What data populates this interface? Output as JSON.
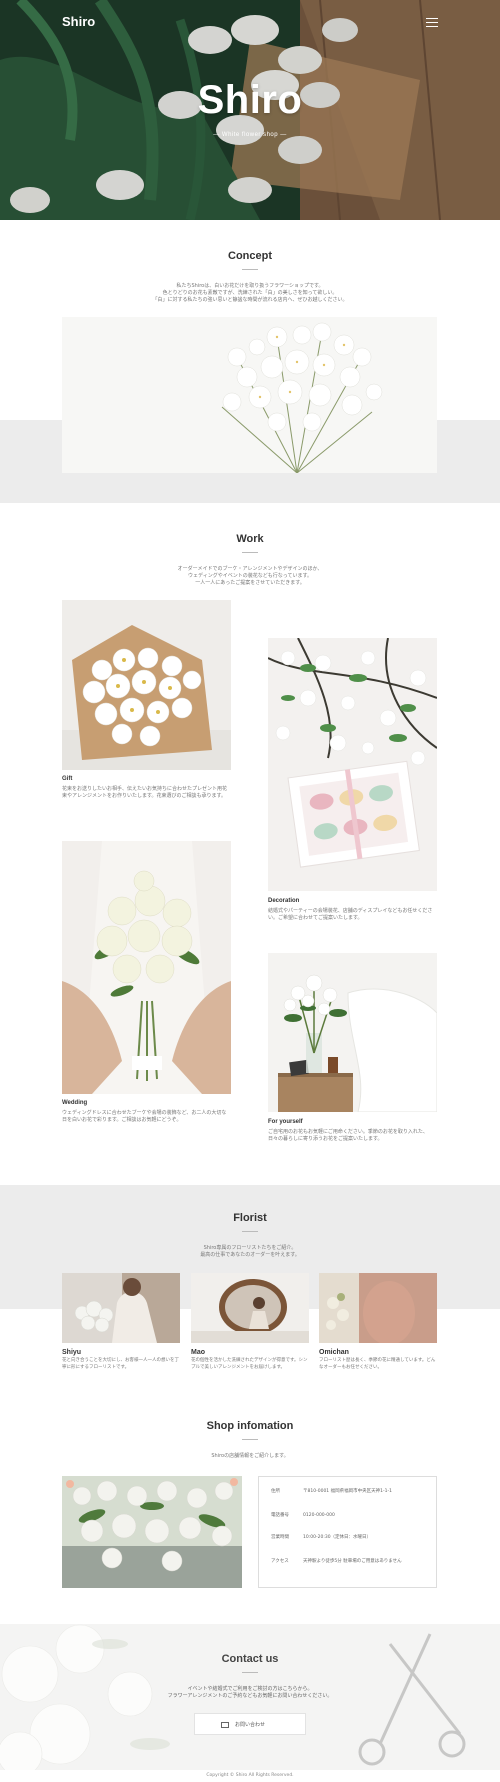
{
  "header": {
    "brand": "Shiro",
    "menu_icon": "hamburger-menu-icon"
  },
  "hero": {
    "title": "Shiro",
    "subtitle": "— White flower shop —"
  },
  "concept": {
    "title": "Concept",
    "text": [
      "私たちShiroは、白いお花だけを取り扱うフラワーショップです。",
      "色とりどりのお花も素敵ですが、洗練された「白」の美しさを知って欲しい。",
      "「白」に対する私たちの強い思いと静謐な時間が流れる店内へ、ぜひお越しください。"
    ]
  },
  "work": {
    "title": "Work",
    "text": [
      "オーダーメイドでのブーケ・アレンジメントやデザインのほか、",
      "ウェディングやイベントの装花なども行なっています。",
      "一人一人にあったご提案をさせていただきます。"
    ],
    "items": [
      {
        "caption": "Gift",
        "desc": "花束をお送りしたいお相手、伝えたいお気持ちに合わせたプレゼント用花束やアレンジメントをお作りいたします。花束選びのご相談も承ります。"
      },
      {
        "caption": "Decoration",
        "desc": "結婚式やパーティーの会場装花、店舗のディスプレイなどもお任せください。ご希望に合わせてご提案いたします。"
      },
      {
        "caption": "Wedding",
        "desc": "ウェディングドレスに合わせたブーケや会場の装飾など、お二人の大切な日を白いお花で彩ります。ご相談はお気軽にどうぞ。"
      },
      {
        "caption": "For yourself",
        "desc": "ご自宅用のお花もお気軽にご用命ください。季節のお花を取り入れた、日々の暮らしに寄り添うお花をご提案いたします。"
      }
    ]
  },
  "florist": {
    "title": "Florist",
    "text": [
      "Shiro専属のフローリストたちをご紹介。",
      "最高の仕事であなたのオーダーを叶えます。"
    ],
    "members": [
      {
        "name": "Shiyu",
        "desc": "花と向き合うことを大切にし、お客様一人一人の想いを丁寧に形にするフローリストです。"
      },
      {
        "name": "Mao",
        "desc": "花の個性を活かした洗練されたデザインが得意です。シンプルで美しいアレンジメントをお届けします。"
      },
      {
        "name": "Omichan",
        "desc": "フローリスト歴は長く、季節の花に精通しています。どんなオーダーもお任せください。"
      }
    ]
  },
  "shop": {
    "title": "Shop infomation",
    "text": "Shiroの店舗情報をご紹介します。",
    "rows": [
      {
        "key": "住所",
        "value": "〒810-0001 福岡県福岡市中央区天神1-1-1"
      },
      {
        "key": "電話番号",
        "value": "0120-000-000"
      },
      {
        "key": "営業時間",
        "value": "10:00-20:30（定休日：水曜日）"
      },
      {
        "key": "アクセス",
        "value": "天神駅より徒歩5分 駐車場のご用意はありません"
      }
    ]
  },
  "contact": {
    "title": "Contact us",
    "text": [
      "イベントや結婚式でご利用をご検討の方はこちらから。",
      "フラワーアレンジメントのご予約などもお気軽にお問い合わせください。"
    ],
    "button_label": "お問い合わせ",
    "button_icon": "mail-icon"
  },
  "footer": {
    "copyright": "Copyright © Shiro All Rights Reserved."
  }
}
